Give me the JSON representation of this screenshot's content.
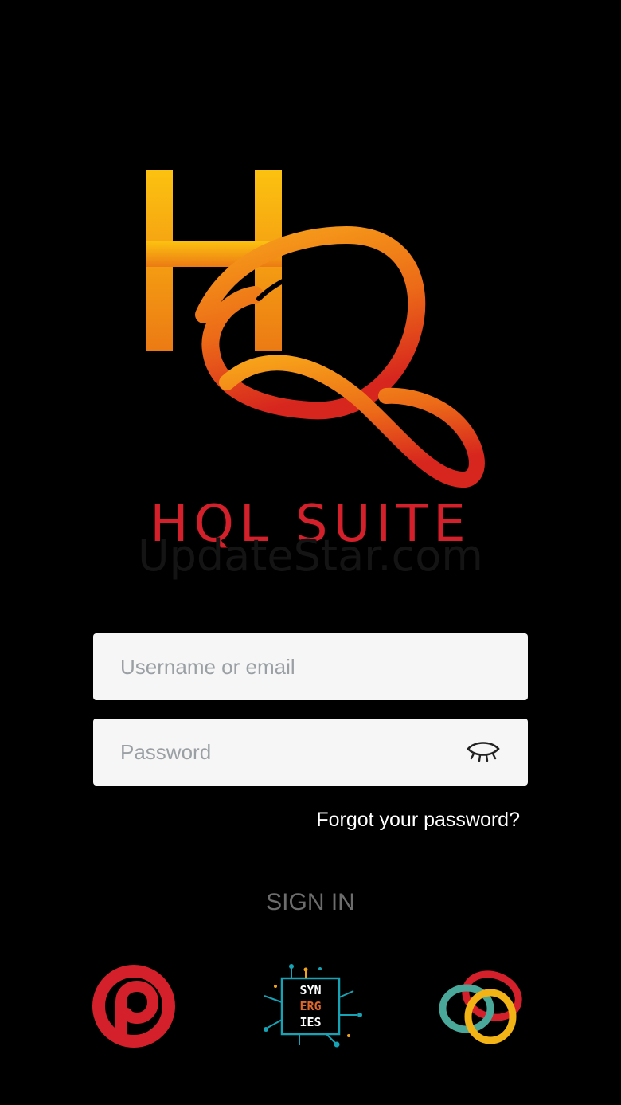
{
  "app": {
    "logo_mark": "HQ",
    "title": "HQL SUITE",
    "watermark": "UpdateStar.com"
  },
  "login": {
    "username_placeholder": "Username or email",
    "username_value": "",
    "password_placeholder": "Password",
    "password_value": "",
    "password_toggle_icon": "eye-closed-icon",
    "forgot_label": "Forgot your password?",
    "signin_label": "SIGN IN"
  },
  "partners": [
    {
      "name": "p-logo",
      "color": "#d4202a"
    },
    {
      "name": "synergies-logo",
      "lines": [
        "SYN",
        "ERG",
        "IES"
      ],
      "colors": [
        "#16a3b5",
        "#f0a41c",
        "#e1662a"
      ]
    },
    {
      "name": "rings-logo",
      "colors": [
        "#d4202a",
        "#4aa89a",
        "#f2b316"
      ]
    }
  ],
  "colors": {
    "background": "#000000",
    "brand_red": "#d4202a",
    "brand_orange": "#f39c12",
    "field_bg": "#f6f6f6",
    "placeholder": "#9aa0a4",
    "signin_text": "#6d6d6d"
  }
}
